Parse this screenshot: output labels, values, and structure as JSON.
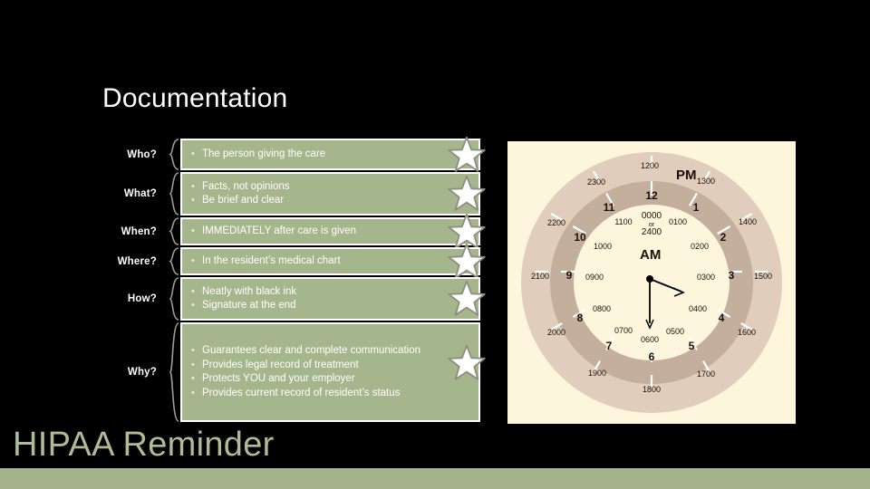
{
  "slide": {
    "background_color": "#000000",
    "accent_color": "#a6b48c",
    "box_color": "#a6b68c",
    "title": "Documentation",
    "footer_title": "HIPAA Reminder"
  },
  "qa_rows": [
    {
      "label": "Who?",
      "bullets": [
        "The person giving the care"
      ],
      "star": true
    },
    {
      "label": "What?",
      "bullets": [
        "Facts, not opinions",
        "Be brief and clear"
      ],
      "star": true
    },
    {
      "label": "When?",
      "bullets": [
        "IMMEDIATELY after care is given"
      ],
      "star": true
    },
    {
      "label": "Where?",
      "bullets": [
        "In the resident’s medical chart"
      ],
      "star": true
    },
    {
      "label": "How?",
      "bullets": [
        "Neatly with black ink",
        "Signature at the end"
      ],
      "star": true
    },
    {
      "label": "Why?",
      "bullets": [
        "Guarantees clear and complete communication",
        "Provides legal record of treatment",
        "Protects YOU and your employer",
        "Provides current record of resident’s status"
      ],
      "star": true
    }
  ],
  "clock": {
    "background_color": "#fdf6dd",
    "outer_ring_color": "#e0cdbb",
    "inner_ring_color": "#c4ae9c",
    "face_color": "#fdf6dd",
    "pm_label": "PM",
    "am_label": "AM",
    "midnight_label_line1": "0000",
    "midnight_label_line2": "or",
    "midnight_label_line3": "2400",
    "hour_numbers": [
      "12",
      "1",
      "2",
      "3",
      "4",
      "5",
      "6",
      "7",
      "8",
      "9",
      "10",
      "11"
    ],
    "outer_military_times": [
      "1200",
      "1300",
      "1400",
      "1500",
      "1600",
      "1700",
      "1800",
      "1900",
      "2000",
      "2100",
      "2200",
      "2300"
    ],
    "inner_military_times": [
      "0100",
      "0200",
      "0300",
      "0400",
      "0500",
      "0600",
      "0700",
      "0800",
      "0900",
      "1000",
      "1100"
    ],
    "hands": [
      {
        "name": "hour-hand",
        "points_to": "6"
      },
      {
        "name": "minute-hand",
        "points_to": "between 2 and 3"
      }
    ]
  }
}
